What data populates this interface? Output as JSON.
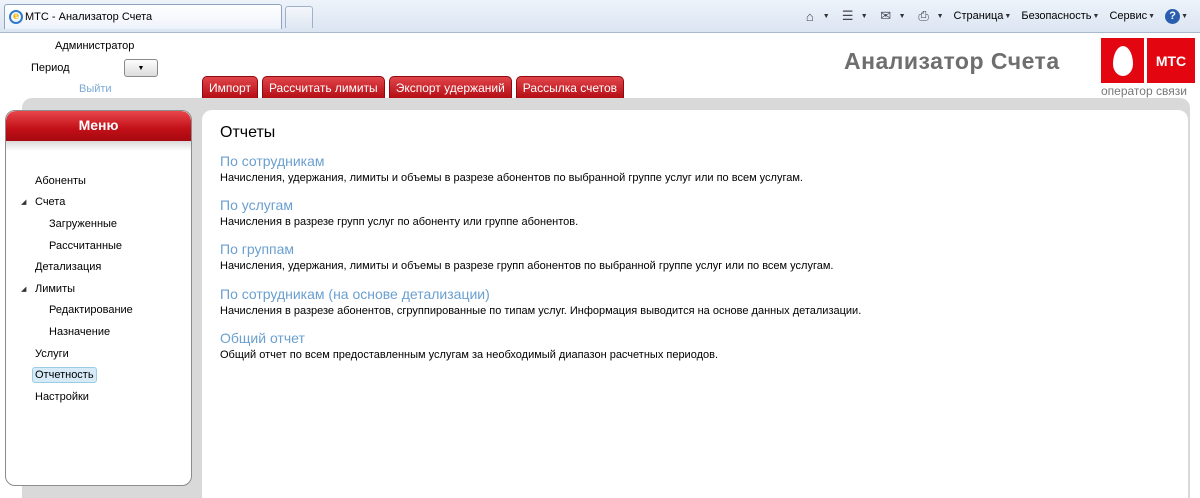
{
  "browser": {
    "tab_title": "МТС - Анализатор Счета",
    "commands": {
      "page": "Страница",
      "security": "Безопасность",
      "service": "Сервис",
      "help": "?"
    }
  },
  "header": {
    "user": "Администратор",
    "period_label": "Период",
    "logout": "Выйти",
    "app_title": "Анализатор Счета",
    "logo_text": "МТС",
    "logo_tagline": "оператор связи",
    "tabs": [
      "Импорт",
      "Рассчитать лимиты",
      "Экспорт удержаний",
      "Рассылка счетов"
    ]
  },
  "sidebar": {
    "title": "Меню",
    "items": [
      {
        "label": "Абоненты"
      },
      {
        "label": "Счета"
      },
      {
        "label": "Загруженные"
      },
      {
        "label": "Рассчитанные"
      },
      {
        "label": "Детализация"
      },
      {
        "label": "Лимиты"
      },
      {
        "label": "Редактирование"
      },
      {
        "label": "Назначение"
      },
      {
        "label": "Услуги"
      },
      {
        "label": "Отчетность"
      },
      {
        "label": "Настройки"
      }
    ]
  },
  "content": {
    "title": "Отчеты",
    "reports": [
      {
        "title": "По сотрудникам",
        "description": "Начисления, удержания, лимиты и объемы в разрезе абонентов по выбранной группе услуг или по всем услугам."
      },
      {
        "title": "По услугам",
        "description": "Начисления в разрезе групп услуг по абоненту или группе абонентов."
      },
      {
        "title": "По группам",
        "description": "Начисления, удержания, лимиты и объемы в разрезе групп абонентов по выбранной группе услуг или по всем услугам."
      },
      {
        "title": "По сотрудникам (на основе детализации)",
        "description": "Начисления в разрезе абонентов, сгруппированные по типам услуг. Информация выводится на основе данных детализации."
      },
      {
        "title": "Общий отчет",
        "description": "Общий отчет по всем предоставленным услугам за необходимый диапазон расчетных периодов."
      }
    ]
  },
  "colors": {
    "accent_red": "#e30611",
    "link_blue": "#6a9fcf",
    "frame_gray": "#d9d9d9"
  }
}
